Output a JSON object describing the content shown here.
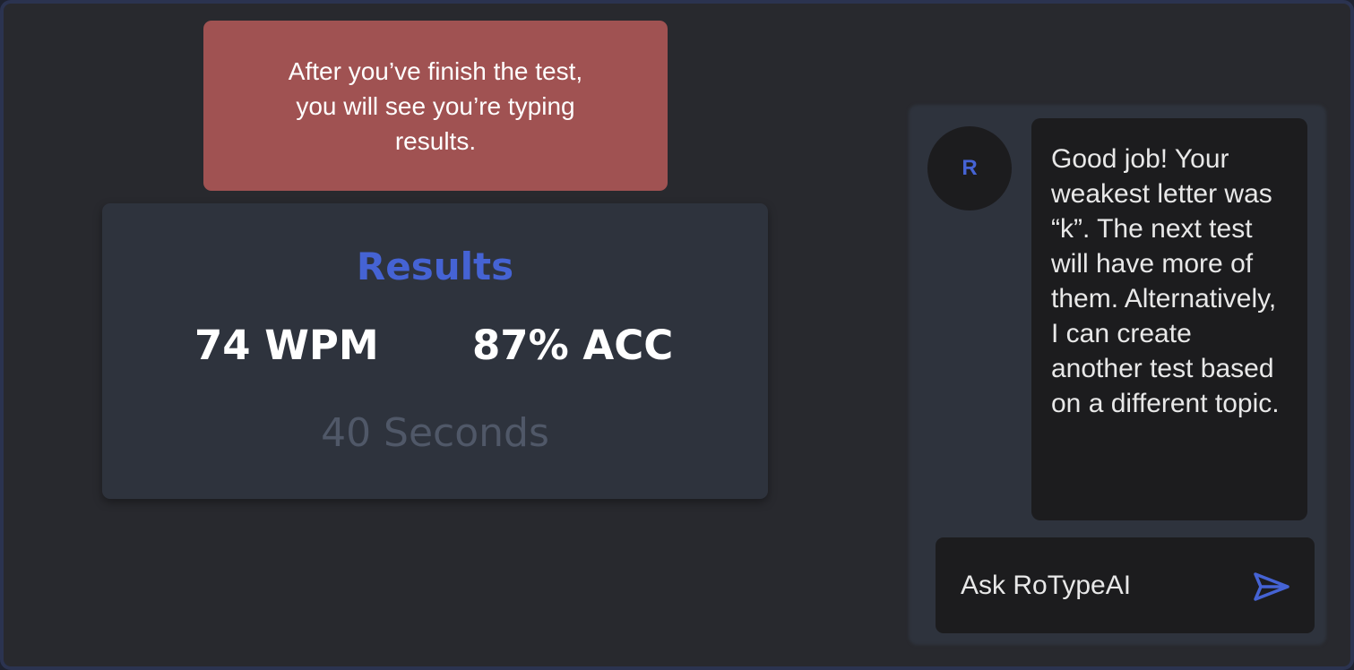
{
  "tooltip": {
    "text": "After you’ve finish the test,\nyou will see you’re typing\nresults."
  },
  "results": {
    "title": "Results",
    "wpm_label": "74 WPM",
    "acc_label": "87% ACC",
    "duration_label": "40 Seconds"
  },
  "chat": {
    "avatar_initial": "R",
    "message": "Good job! Your weakest letter was “k”. The next test will have more of them. Alternatively, I can create another test based on a different topic.",
    "input_placeholder": "Ask RoTypeAI",
    "send_icon": "send-icon"
  },
  "colors": {
    "accent": "#4563d4",
    "tooltip_bg": "#a05252",
    "card_bg": "#2e333d",
    "page_bg": "#28292e",
    "muted_text": "#505868"
  }
}
